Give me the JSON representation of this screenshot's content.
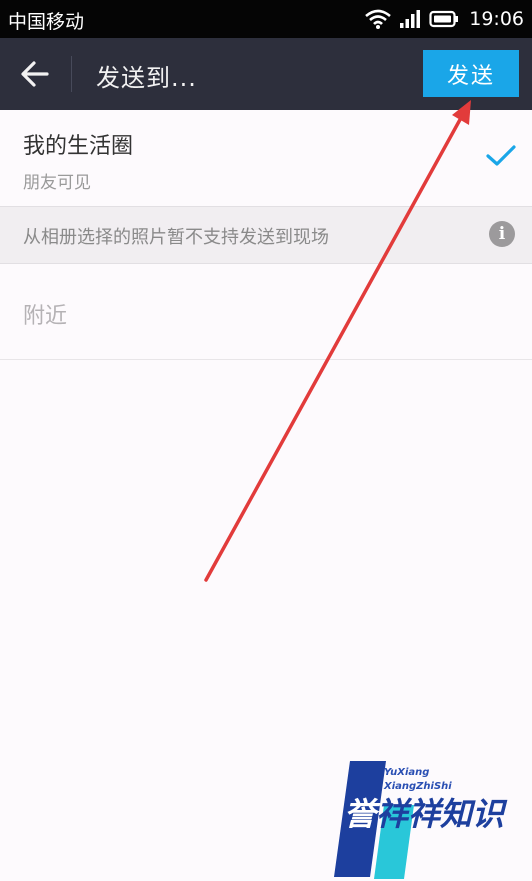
{
  "status_bar": {
    "carrier": "中国移动",
    "time": "19:06",
    "icons": [
      "wifi-icon",
      "signal-icon",
      "battery-icon"
    ]
  },
  "header": {
    "title": "发送到...",
    "back_icon": "back-arrow-icon",
    "send_label": "发送"
  },
  "options": {
    "life_circle": {
      "title": "我的生活圈",
      "subtitle": "朋友可见",
      "selected": true
    },
    "notice": "从相册选择的照片暂不支持发送到现场",
    "notice_icon": "i",
    "nearby": {
      "label": "附近"
    }
  },
  "watermark": {
    "line1": "YuXiang",
    "line2": "XiangZhiShi",
    "brand_first": "誉",
    "brand_rest": "祥祥知识"
  },
  "colors": {
    "accent": "#1aa6e8",
    "header_bg": "#2d2f3c",
    "annotation_arrow": "#e23b3b"
  }
}
